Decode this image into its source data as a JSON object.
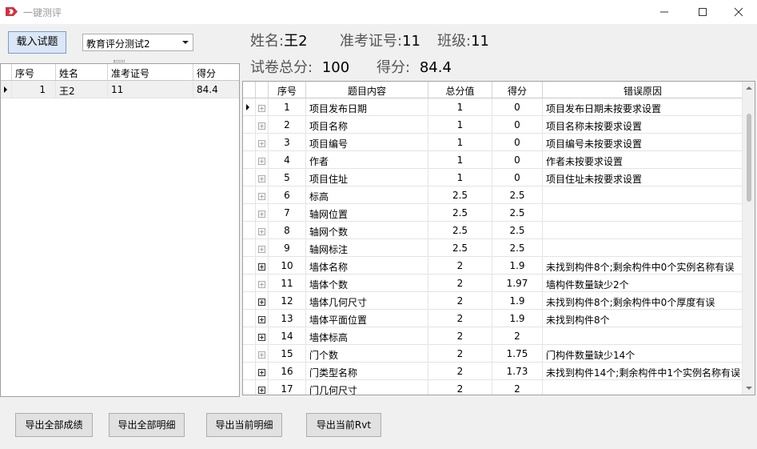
{
  "window": {
    "title": "一键测评"
  },
  "toolbar": {
    "load_button": "载入试题",
    "exam_select_value": "教育评分测试2"
  },
  "student_list": {
    "columns": [
      "序号",
      "姓名",
      "准考证号",
      "得分"
    ],
    "rows": [
      {
        "no": "1",
        "name": "王2",
        "exam_id": "11",
        "score": "84.4"
      }
    ]
  },
  "student_info": {
    "name_label": "姓名:",
    "name_value": "王2",
    "id_label": "准考证号:",
    "id_value": "11",
    "class_label": "班级:",
    "class_value": "11",
    "total_label": "试卷总分:",
    "total_value": "100",
    "score_label": "得分:",
    "score_value": "84.4"
  },
  "detail_grid": {
    "columns": [
      "序号",
      "题目内容",
      "总分值",
      "得分",
      "错误原因"
    ],
    "rows": [
      {
        "no": "1",
        "topic": "项目发布日期",
        "total": "1",
        "score": "0",
        "reason": "项目发布日期未按要求设置",
        "expandable": false
      },
      {
        "no": "2",
        "topic": "项目名称",
        "total": "1",
        "score": "0",
        "reason": "项目名称未按要求设置",
        "expandable": false
      },
      {
        "no": "3",
        "topic": "项目编号",
        "total": "1",
        "score": "0",
        "reason": "项目编号未按要求设置",
        "expandable": false
      },
      {
        "no": "4",
        "topic": "作者",
        "total": "1",
        "score": "0",
        "reason": "作者未按要求设置",
        "expandable": false
      },
      {
        "no": "5",
        "topic": "项目住址",
        "total": "1",
        "score": "0",
        "reason": "项目住址未按要求设置",
        "expandable": false
      },
      {
        "no": "6",
        "topic": "标高",
        "total": "2.5",
        "score": "2.5",
        "reason": "",
        "expandable": false
      },
      {
        "no": "7",
        "topic": "轴网位置",
        "total": "2.5",
        "score": "2.5",
        "reason": "",
        "expandable": false
      },
      {
        "no": "8",
        "topic": "轴网个数",
        "total": "2.5",
        "score": "2.5",
        "reason": "",
        "expandable": false
      },
      {
        "no": "9",
        "topic": "轴网标注",
        "total": "2.5",
        "score": "2.5",
        "reason": "",
        "expandable": false
      },
      {
        "no": "10",
        "topic": "墙体名称",
        "total": "2",
        "score": "1.9",
        "reason": "未找到构件8个;剩余构件中0个实例名称有误",
        "expandable": true
      },
      {
        "no": "11",
        "topic": "墙体个数",
        "total": "2",
        "score": "1.97",
        "reason": "墙构件数量缺少2个",
        "expandable": false
      },
      {
        "no": "12",
        "topic": "墙体几何尺寸",
        "total": "2",
        "score": "1.9",
        "reason": "未找到构件8个;剩余构件中0个厚度有误",
        "expandable": true
      },
      {
        "no": "13",
        "topic": "墙体平面位置",
        "total": "2",
        "score": "1.9",
        "reason": "未找到构件8个",
        "expandable": true
      },
      {
        "no": "14",
        "topic": "墙体标高",
        "total": "2",
        "score": "2",
        "reason": "",
        "expandable": true
      },
      {
        "no": "15",
        "topic": "门个数",
        "total": "2",
        "score": "1.75",
        "reason": "门构件数量缺少14个",
        "expandable": false
      },
      {
        "no": "16",
        "topic": "门类型名称",
        "total": "2",
        "score": "1.73",
        "reason": "未找到构件14个;剩余构件中1个实例名称有误",
        "expandable": true
      },
      {
        "no": "17",
        "topic": "门几何尺寸",
        "total": "2",
        "score": "2",
        "reason": "",
        "expandable": true
      }
    ]
  },
  "footer": {
    "export_all_scores": "导出全部成绩",
    "export_all_details": "导出全部明细",
    "export_current_detail": "导出当前明细",
    "export_current_rvt": "导出当前Rvt"
  },
  "colors": {
    "load_button_bg": "#dbe7f6",
    "logo_red": "#d32f3c"
  }
}
